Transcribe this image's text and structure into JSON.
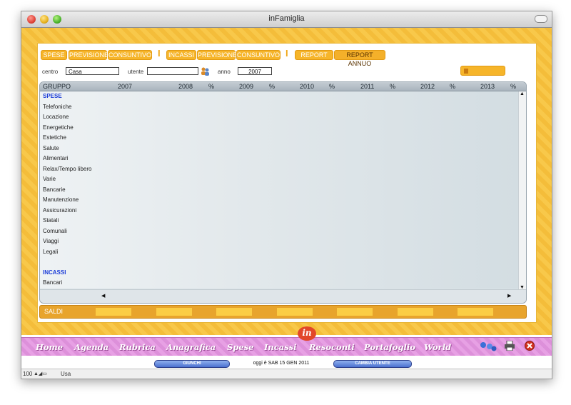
{
  "window": {
    "title": "inFamiglia"
  },
  "tabs": {
    "spese": "SPESE",
    "spese_previsione": "PREVISIONE",
    "spese_consuntivo": "CONSUNTIVO",
    "incassi": "INCASSI",
    "incassi_previsione": "PREVISIONE",
    "incassi_consuntivo": "CONSUNTIVO",
    "report": "REPORT",
    "report_annuo": "REPORT ANNUO"
  },
  "filters": {
    "centro_label": "centro",
    "centro_value": "Casa",
    "utente_label": "utente",
    "utente_value": "",
    "anno_label": "anno",
    "anno_value": "2007",
    "riepilogo": "RIEPILOGO"
  },
  "table": {
    "columns": [
      "GRUPPO",
      "2007",
      "2008",
      "%",
      "2009",
      "%",
      "2010",
      "%",
      "2011",
      "%",
      "2012",
      "%",
      "2013",
      "%"
    ],
    "rows": [
      {
        "label": "SPESE",
        "type": "head"
      },
      {
        "label": "Telefoniche"
      },
      {
        "label": "Locazione"
      },
      {
        "label": "Energetiche"
      },
      {
        "label": "Estetiche"
      },
      {
        "label": "Salute"
      },
      {
        "label": "Alimentari"
      },
      {
        "label": "Relax/Tempo libero"
      },
      {
        "label": "Varie"
      },
      {
        "label": "Bancarie"
      },
      {
        "label": "Manutenzione"
      },
      {
        "label": "Assicurazioni"
      },
      {
        "label": "Statali"
      },
      {
        "label": "Comunali"
      },
      {
        "label": "Viaggi"
      },
      {
        "label": "Legali"
      },
      {
        "label": ""
      },
      {
        "label": "INCASSI",
        "type": "head"
      },
      {
        "label": "Bancari"
      }
    ],
    "saldi_label": "SALDI"
  },
  "nav": {
    "items": [
      "Home",
      "Agenda",
      "Rubrica",
      "Anagrafica",
      "Spese",
      "Incassi",
      "Resoconti",
      "Portafoglio",
      "World"
    ],
    "logo": "in"
  },
  "status": {
    "giunchi": "GIUNCHI",
    "today": "oggi è   SAB 15 GEN 2011",
    "cambia_utente": "CAMBIA UTENTE"
  },
  "bottom": {
    "zoom": "100",
    "mode": "Usa"
  },
  "colors": {
    "accent": "#f6b52a",
    "nav_bg": "#e7a0e4",
    "section_text": "#1a3cd8"
  }
}
